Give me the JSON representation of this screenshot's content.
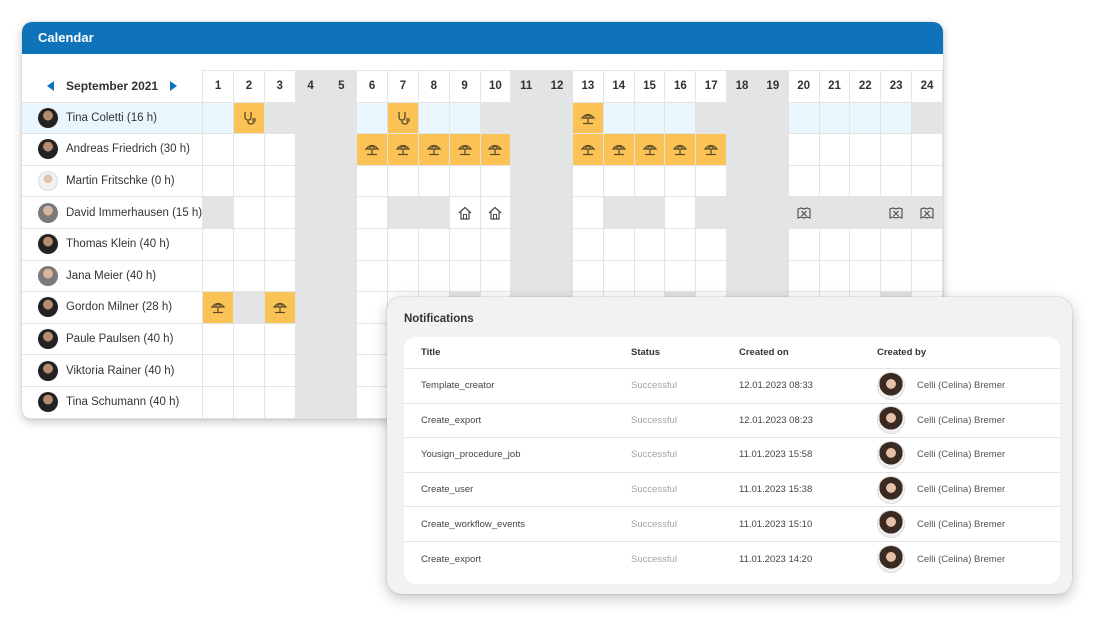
{
  "calendar": {
    "title": "Calendar",
    "month": "September 2021",
    "days": [
      "1",
      "2",
      "3",
      "4",
      "5",
      "6",
      "7",
      "8",
      "9",
      "10",
      "11",
      "12",
      "13",
      "14",
      "15",
      "16",
      "17",
      "18",
      "19",
      "20",
      "21",
      "22",
      "23",
      "24"
    ],
    "weekend_days": [
      4,
      5,
      11,
      12,
      18,
      19
    ],
    "employees": [
      {
        "name": "Tina Coletti (16 h)",
        "avatar": "dark",
        "selected": true,
        "cells": "wsggggwsgggg bwwwggwwwwwg"
      },
      {
        "name": "Andreas Friedrich (30 h)",
        "avatar": "dark"
      },
      {
        "name": "Martin Fritschke (0 h)",
        "avatar": "light"
      },
      {
        "name": "David Immerhausen (15 h)",
        "avatar": "grey"
      },
      {
        "name": "Thomas Klein (40 h)",
        "avatar": "dark"
      },
      {
        "name": "Jana Meier (40 h)",
        "avatar": "grey"
      },
      {
        "name": "Gordon Milner (28 h)",
        "avatar": "dark"
      },
      {
        "name": "Paule Paulsen (40 h)",
        "avatar": "dark"
      },
      {
        "name": "Viktoria Rainer (40 h)",
        "avatar": "dark"
      },
      {
        "name": "Tina Schumann (40 h)",
        "avatar": "dark"
      }
    ],
    "rows": [
      [
        "w",
        "y:stethoscope-icon",
        "g",
        "g",
        "g",
        "w",
        "y:stethoscope-icon",
        "w",
        "w",
        "g",
        "g",
        "g",
        "y:beach-icon",
        "w",
        "w",
        "w",
        "g",
        "g",
        "g",
        "w",
        "w",
        "w",
        "w",
        "g"
      ],
      [
        "w",
        "w",
        "w",
        "g",
        "g",
        "y:beach-icon",
        "y:beach-icon",
        "y:beach-icon",
        "y:beach-icon",
        "y:beach-icon",
        "g",
        "g",
        "y:beach-icon",
        "y:beach-icon",
        "y:beach-icon",
        "y:beach-icon",
        "y:beach-icon",
        "g",
        "g",
        "w",
        "w",
        "w",
        "w",
        "w"
      ],
      [
        "w",
        "w",
        "w",
        "g",
        "g",
        "w",
        "w",
        "w",
        "w",
        "w",
        "g",
        "g",
        "w",
        "w",
        "w",
        "w",
        "w",
        "g",
        "g",
        "w",
        "w",
        "w",
        "w",
        "w"
      ],
      [
        "g",
        "w",
        "w",
        "g",
        "g",
        "w",
        "g",
        "g",
        "h:home-office-icon",
        "h:home-office-icon",
        "g",
        "g",
        "w",
        "g",
        "g",
        "w",
        "g",
        "g",
        "g",
        "gi:training-icon",
        "g",
        "g",
        "gi:training-icon",
        "gi:training-icon"
      ],
      [
        "w",
        "w",
        "w",
        "g",
        "g",
        "w",
        "w",
        "w",
        "w",
        "w",
        "g",
        "g",
        "w",
        "w",
        "w",
        "w",
        "w",
        "g",
        "g",
        "w",
        "w",
        "w",
        "w",
        "w"
      ],
      [
        "w",
        "w",
        "w",
        "g",
        "g",
        "w",
        "w",
        "w",
        "w",
        "w",
        "g",
        "g",
        "w",
        "w",
        "w",
        "w",
        "w",
        "g",
        "g",
        "w",
        "w",
        "w",
        "w",
        "w"
      ],
      [
        "y:beach-icon",
        "g",
        "y:beach-icon",
        "g",
        "g",
        "w",
        "w",
        "w",
        "g",
        "w",
        "g",
        "g",
        "w",
        "w",
        "w",
        "g",
        "w",
        "g",
        "g",
        "w",
        "w",
        "w",
        "g",
        "w"
      ],
      [
        "w",
        "w",
        "w",
        "g",
        "g",
        "w",
        "w",
        "w",
        "w",
        "w",
        "g",
        "g",
        "w",
        "w",
        "w",
        "w",
        "w",
        "g",
        "g",
        "w",
        "w",
        "w",
        "w",
        "w"
      ],
      [
        "w",
        "w",
        "w",
        "g",
        "g",
        "w",
        "w",
        "w",
        "w",
        "w",
        "g",
        "g",
        "w",
        "w",
        "w",
        "w",
        "w",
        "g",
        "g",
        "w",
        "w",
        "w",
        "w",
        "w"
      ],
      [
        "w",
        "w",
        "w",
        "g",
        "g",
        "w",
        "w",
        "w",
        "w",
        "w",
        "g",
        "g",
        "w",
        "w",
        "w",
        "w",
        "w",
        "g",
        "g",
        "w",
        "w",
        "w",
        "w",
        "w"
      ]
    ]
  },
  "notifications": {
    "title": "Notifications",
    "columns": {
      "title": "Title",
      "status": "Status",
      "created_on": "Created on",
      "created_by": "Created by"
    },
    "rows": [
      {
        "title": "Template_creator",
        "status": "Successful",
        "created_on": "12.01.2023 08:33",
        "created_by": "Celli (Celina) Bremer"
      },
      {
        "title": "Create_export",
        "status": "Successful",
        "created_on": "12.01.2023 08:23",
        "created_by": "Celli (Celina) Bremer"
      },
      {
        "title": "Yousign_procedure_job",
        "status": "Successful",
        "created_on": "11.01.2023 15:58",
        "created_by": "Celli (Celina) Bremer"
      },
      {
        "title": "Create_user",
        "status": "Successful",
        "created_on": "11.01.2023 15:38",
        "created_by": "Celli (Celina) Bremer"
      },
      {
        "title": "Create_workflow_events",
        "status": "Successful",
        "created_on": "11.01.2023 15:10",
        "created_by": "Celli (Celina) Bremer"
      },
      {
        "title": "Create_export",
        "status": "Successful",
        "created_on": "11.01.2023 14:20",
        "created_by": "Celli (Celina) Bremer"
      }
    ]
  },
  "colors": {
    "header_blue": "#0e73b9",
    "absence_yellow": "#fbc356",
    "weekend_grey": "#e3e4e6",
    "home_office_green": "#e9f4d8",
    "selected_row": "#eaf6fd"
  }
}
